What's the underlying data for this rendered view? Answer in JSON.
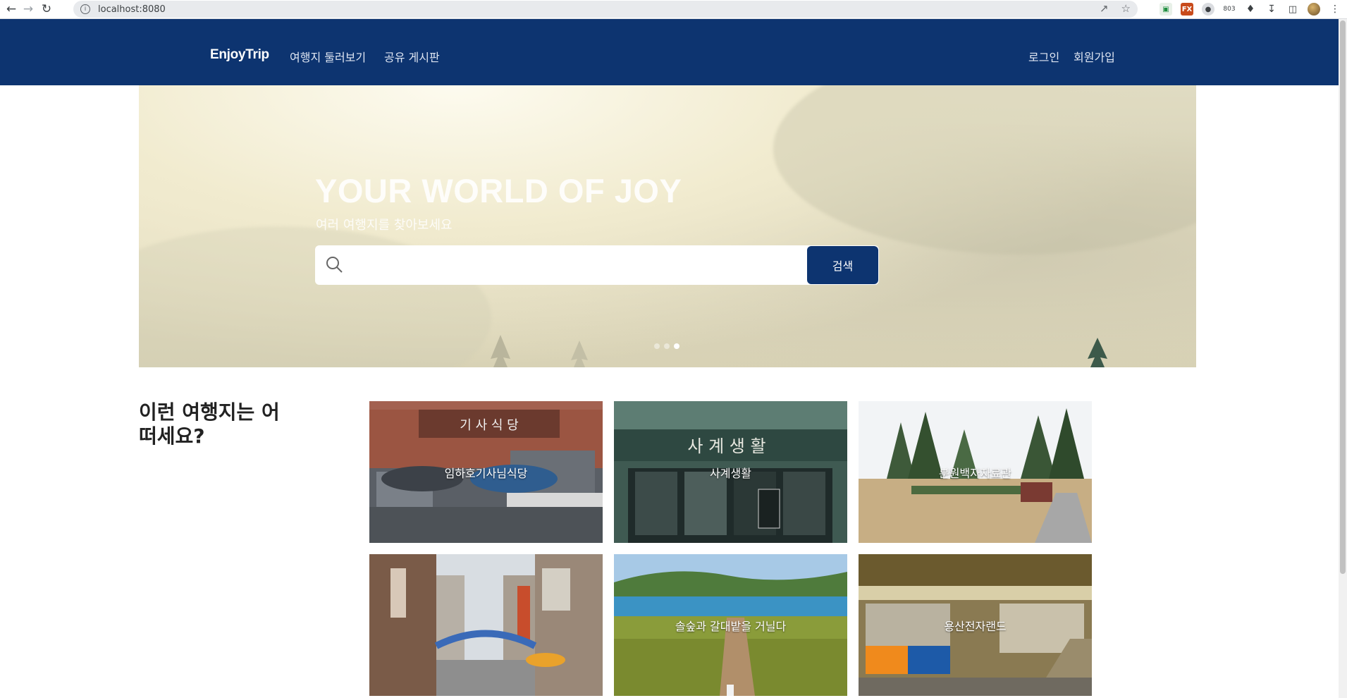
{
  "browser": {
    "url": "localhost:8080"
  },
  "header": {
    "brand": "EnjoyTrip",
    "nav": [
      "여행지 둘러보기",
      "공유 게시판"
    ],
    "auth": [
      "로그인",
      "회원가입"
    ]
  },
  "hero": {
    "title": "YOUR WORLD OF JOY",
    "subtitle": "여러 여행지를 찾아보세요",
    "search_placeholder": "",
    "search_button": "검색",
    "slides": 3,
    "active_slide": 3
  },
  "recommend": {
    "title": "이런 여행지는 어떠세요?",
    "places": [
      "임하호기사님식당",
      "사계생활",
      "분원백자자료관",
      "",
      "솔숲과 갈대밭을 거닐다",
      "용산전자랜드"
    ]
  },
  "colors": {
    "header": "#0d3470",
    "button": "#0d3470"
  }
}
